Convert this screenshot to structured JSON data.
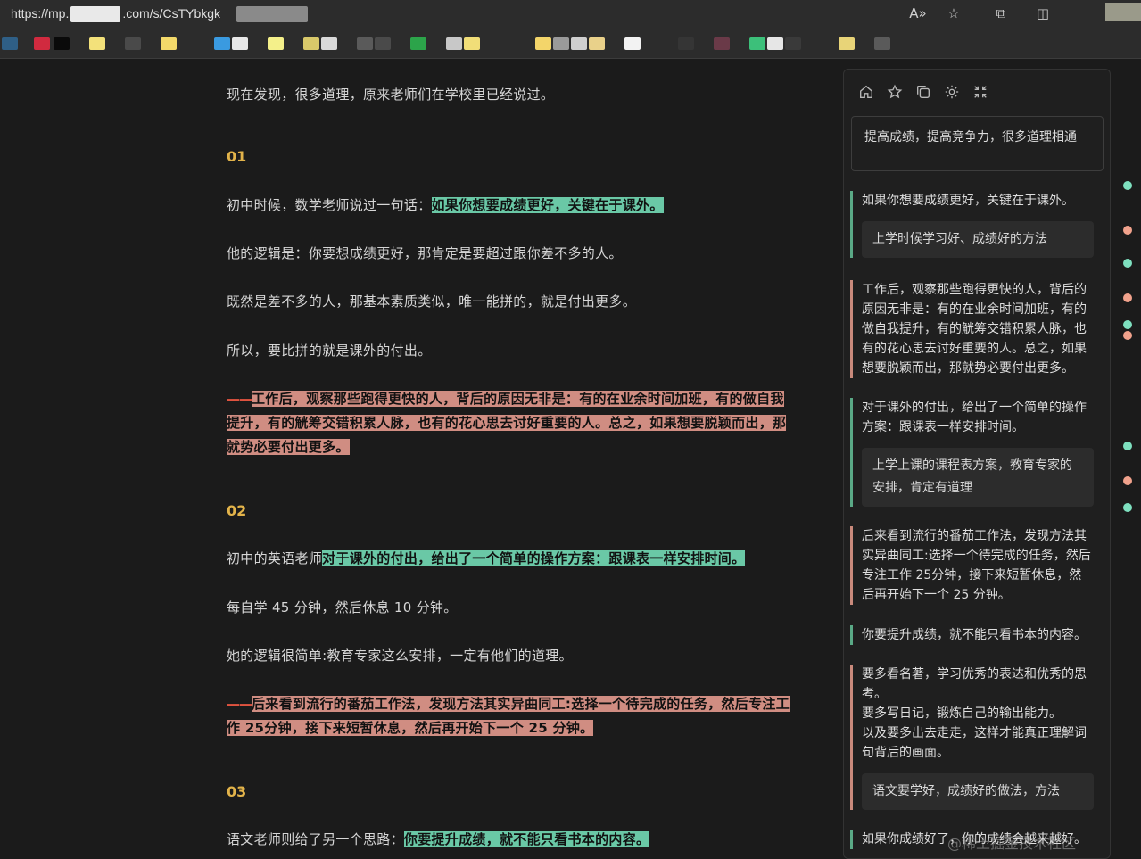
{
  "browser": {
    "url_prefix": "https://mp.",
    "url_suffix": ".com/s/CsTYbkgk",
    "read_aloud_icon": "A»",
    "favorite_icon": "☆",
    "extensions_icon": "⧉",
    "split_icon": "◫"
  },
  "article": {
    "intro": "现在发现，很多道理，原来老师们在学校里已经说过。",
    "section1": {
      "num": "01",
      "p1_prefix": "初中时候，数学老师说过一句话：",
      "p1_highlight": "如果你想要成绩更好，关键在于课外。",
      "p2": "他的逻辑是：你要想成绩更好，那肯定是要超过跟你差不多的人。",
      "p3": "既然是差不多的人，那基本素质类似，唯一能拼的，就是付出更多。",
      "p4": "所以，要比拼的就是课外的付出。",
      "p5_dash": "——",
      "p5_line1": "工作后，观察那些跑得更快的人，背后的原因无非是：有的在业余时间加班，有的做自我",
      "p5_line2": "提升，有的觥筹交错积累人脉，也有的花心思去讨好重要的人。总之，如果想要脱颖而出，那",
      "p5_line3": "就势必要付出更多。"
    },
    "section2": {
      "num": "02",
      "p1_prefix": "初中的英语老师",
      "p1_highlight": "对于课外的付出，给出了一个简单的操作方案：跟课表一样安排时间。",
      "p2": "每自学 45 分钟，然后休息 10 分钟。",
      "p3": "她的逻辑很简单:教育专家这么安排，一定有他们的道理。",
      "p4_dash": "——",
      "p4_line1": "后来看到流行的番茄工作法，发现方法其实异曲同工:选择一个待完成的任务，然后专注工",
      "p4_line2": "作 25分钟，接下来短暂休息，然后再开始下一个 25 分钟。"
    },
    "section3": {
      "num": "03",
      "p1_prefix": "语文老师则给了另一个思路：",
      "p1_highlight": "你要提升成绩，就不能只看书本的内容。"
    }
  },
  "panel": {
    "title": "提高成绩，提高竞争力，很多道理相通",
    "notes": [
      {
        "text": "如果你想要成绩更好，关键在于课外。",
        "reply": "上学时候学习好、成绩好的方法"
      },
      {
        "text": "工作后，观察那些跑得更快的人，背后的原因无非是：有的在业余时间加班，有的做自我提升，有的觥筹交错积累人脉，也有的花心思去讨好重要的人。总之，如果想要脱颖而出，那就势必要付出更多。"
      },
      {
        "text": "对于课外的付出，给出了一个简单的操作方案：跟课表一样安排时间。",
        "reply": "上学上课的课程表方案，教育专家的安排，肯定有道理"
      },
      {
        "text": "后来看到流行的番茄工作法，发现方法其实异曲同工:选择一个待完成的任务，然后专注工作 25分钟，接下来短暂休息，然后再开始下一个 25 分钟。"
      },
      {
        "text": "你要提升成绩，就不能只看书本的内容。"
      },
      {
        "line1": "要多看名著，学习优秀的表达和优秀的思考。",
        "line2": "要多写日记，锻炼自己的输出能力。",
        "line3": "以及要多出去走走，这样才能真正理解词句背后的画面。",
        "reply": "语文要学好，成绩好的做法，方法"
      },
      {
        "text": "如果你成绩好了，你的成绩会越来越好。"
      }
    ]
  },
  "watermark": "@稀土掘金技术社区",
  "colors": {
    "highlight_green": "#6ac8a6",
    "highlight_red": "#d08d82",
    "section_number": "#e2b34a"
  }
}
